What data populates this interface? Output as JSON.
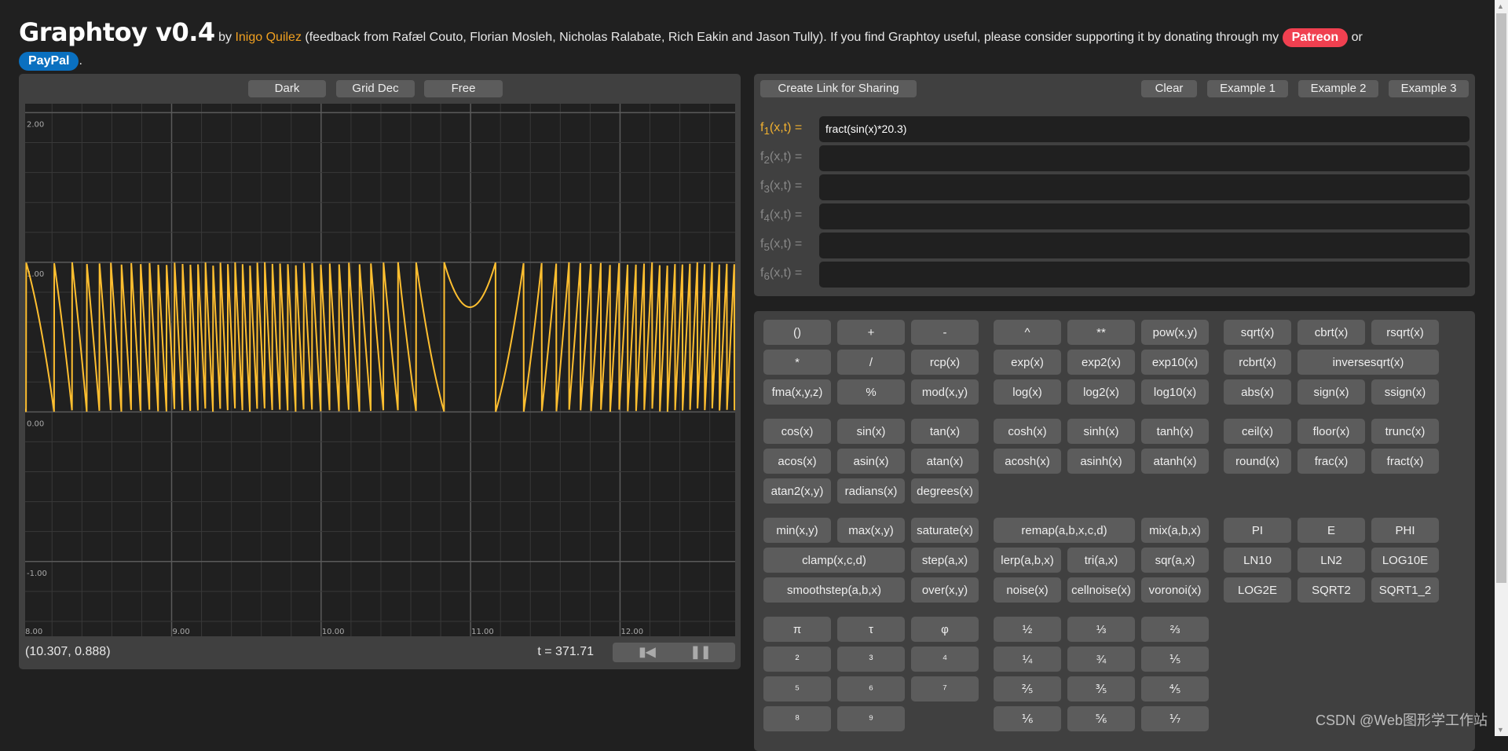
{
  "header": {
    "title": "Graphtoy v0.4",
    "by": "by ",
    "author": "Inigo Quilez",
    "credits": " (feedback from Rafæl Couto, Florian Mosleh, Nicholas Ralabate, Rich Eakin and Jason Tully). If you find Graphtoy useful, please consider supporting it by donating through my ",
    "patreon": "Patreon",
    "or": " or ",
    "paypal": "PayPal",
    "end": "."
  },
  "graph": {
    "toolbar": {
      "theme": "Dark",
      "grid": "Grid Dec",
      "mode": "Free"
    },
    "coord": "(10.307, 0.888)",
    "time": "t = 371.71",
    "rewind_icon": "rewind-icon",
    "pause_icon": "pause-icon"
  },
  "chart_data": {
    "type": "line",
    "series": [
      {
        "expression": "fract(sin(x)*20.3)",
        "color": "#ffbf30"
      }
    ],
    "xlim": [
      8.02,
      12.77
    ],
    "ylim": [
      -1.5,
      2.06
    ],
    "x_ticks": [
      "8.00",
      "9.00",
      "10.00",
      "11.00",
      "12.00"
    ],
    "y_ticks": [
      "2.00",
      "1.00",
      "0.00",
      "-1.00"
    ],
    "grid": true,
    "grid_minor_step": 0.2
  },
  "functions": {
    "share": "Create Link for Sharing",
    "clear": "Clear",
    "examples": [
      "Example 1",
      "Example 2",
      "Example 3"
    ],
    "rows": [
      {
        "label": "f",
        "sub": "1",
        "args": "(x,t) =",
        "value": "fract(sin(x)*20.3)"
      },
      {
        "label": "f",
        "sub": "2",
        "args": "(x,t) =",
        "value": ""
      },
      {
        "label": "f",
        "sub": "3",
        "args": "(x,t) =",
        "value": ""
      },
      {
        "label": "f",
        "sub": "4",
        "args": "(x,t) =",
        "value": ""
      },
      {
        "label": "f",
        "sub": "5",
        "args": "(x,t) =",
        "value": ""
      },
      {
        "label": "f",
        "sub": "6",
        "args": "(x,t) =",
        "value": ""
      }
    ]
  },
  "buttons": [
    [
      [
        "()",
        "+",
        "-",
        "^",
        "**",
        "pow(x,y)",
        "sqrt(x)",
        "cbrt(x)",
        "rsqrt(x)"
      ],
      [
        "*",
        "/",
        "rcp(x)",
        "exp(x)",
        "exp2(x)",
        "exp10(x)",
        "rcbrt(x)",
        "inversesqrt(x)"
      ],
      [
        "fma(x,y,z)",
        "%",
        "mod(x,y)",
        "log(x)",
        "log2(x)",
        "log10(x)",
        "abs(x)",
        "sign(x)",
        "ssign(x)"
      ]
    ],
    [
      [
        "cos(x)",
        "sin(x)",
        "tan(x)",
        "cosh(x)",
        "sinh(x)",
        "tanh(x)",
        "ceil(x)",
        "floor(x)",
        "trunc(x)"
      ],
      [
        "acos(x)",
        "asin(x)",
        "atan(x)",
        "acosh(x)",
        "asinh(x)",
        "atanh(x)",
        "round(x)",
        "frac(x)",
        "fract(x)"
      ],
      [
        "atan2(x,y)",
        "radians(x)",
        "degrees(x)"
      ]
    ],
    [
      [
        "min(x,y)",
        "max(x,y)",
        "saturate(x)",
        "remap(a,b,x,c,d)",
        "mix(a,b,x)",
        "PI",
        "E",
        "PHI"
      ],
      [
        "clamp(x,c,d)",
        "step(a,x)",
        "lerp(a,b,x)",
        "tri(a,x)",
        "sqr(a,x)",
        "LN10",
        "LN2",
        "LOG10E"
      ],
      [
        "smoothstep(a,b,x)",
        "over(x,y)",
        "noise(x)",
        "cellnoise(x)",
        "voronoi(x)",
        "LOG2E",
        "SQRT2",
        "SQRT1_2"
      ]
    ],
    [
      [
        "π",
        "τ",
        "φ",
        "½",
        "⅓",
        "⅔"
      ],
      [
        "²",
        "³",
        "⁴",
        "¼",
        "¾",
        "⅕"
      ],
      [
        "⁵",
        "⁶",
        "⁷",
        "⅖",
        "⅗",
        "⅘"
      ],
      [
        "⁸",
        "⁹",
        null,
        "⅙",
        "⅚",
        "⅐"
      ]
    ]
  ],
  "watermark": "CSDN @Web图形学工作站"
}
